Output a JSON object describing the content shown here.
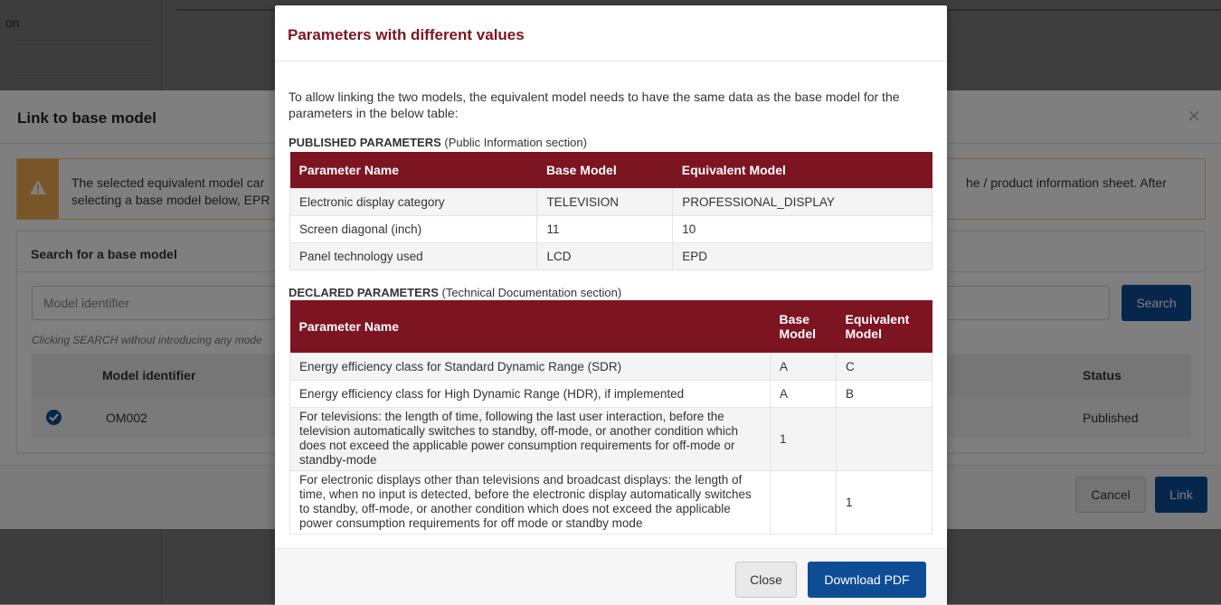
{
  "background": {
    "sidebar_fragment": "on"
  },
  "link_modal": {
    "title": "Link to base model",
    "close_glyph": "×",
    "warning": {
      "text_left": "The selected equivalent model car selecting a base model below, EPR",
      "text_right_line1": "he / product information sheet. After"
    },
    "search": {
      "section_title": "Search for a base model",
      "input_placeholder": "Model identifier",
      "search_label": "Search",
      "hint": "Clicking SEARCH without introducing any mode"
    },
    "results": {
      "col_model": "Model identifier",
      "col_status": "Status",
      "rows": [
        {
          "model": "OM002",
          "status": "Published",
          "selected": true
        }
      ]
    },
    "cancel_label": "Cancel",
    "link_label": "Link"
  },
  "param_modal": {
    "title": "Parameters with different values",
    "intro": "To allow linking the two models, the equivalent model needs to have the same data as the base model for the parameters in the below table:",
    "published": {
      "label_bold": "PUBLISHED PARAMETERS",
      "label_rest": " (Public Information section)",
      "headers": [
        "Parameter Name",
        "Base Model",
        "Equivalent Model"
      ],
      "rows": [
        [
          "Electronic display category",
          "TELEVISION",
          "PROFESSIONAL_DISPLAY"
        ],
        [
          "Screen diagonal (inch)",
          "11",
          "10"
        ],
        [
          "Panel technology used",
          "LCD",
          "EPD"
        ]
      ]
    },
    "declared": {
      "label_bold": "DECLARED PARAMETERS",
      "label_rest": " (Technical Documentation section)",
      "headers": [
        "Parameter Name",
        "Base Model",
        "Equivalent Model"
      ],
      "rows": [
        [
          "Energy efficiency class for Standard Dynamic Range (SDR)",
          "A",
          "C"
        ],
        [
          "Energy efficiency class for High Dynamic Range (HDR), if implemented",
          "A",
          "B"
        ],
        [
          "For televisions: the length of time, following the last user interaction, before the television automatically switches to standby, off-mode, or another condition which does not exceed the applicable power consumption requirements for off-mode or standby-mode",
          "1",
          ""
        ],
        [
          "For electronic displays other than televisions and broadcast displays: the length of time, when no input is detected, before the electronic display automatically switches to standby, off-mode, or another condition which does not exceed the applicable power consumption requirements for off mode or standby mode",
          "",
          "1"
        ]
      ]
    },
    "close_label": "Close",
    "download_label": "Download PDF"
  },
  "colors": {
    "brand_red": "#7d1421",
    "primary_blue": "#0f4c96",
    "warning_orange": "#f0ad4e"
  }
}
